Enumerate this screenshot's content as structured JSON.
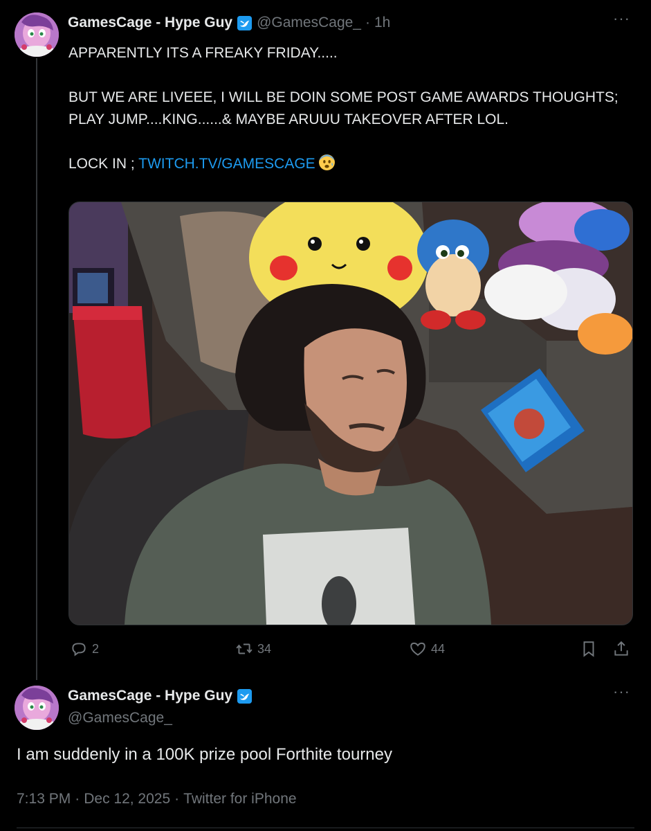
{
  "colors": {
    "background": "#000000",
    "text": "#e7e9ea",
    "muted": "#71767b",
    "link": "#1d9bf0",
    "verified": "#1d9bf0",
    "divider": "#2f3336"
  },
  "tweet1": {
    "display_name": "GamesCage - Hype Guy",
    "handle": "@GamesCage_",
    "separator": "·",
    "time": "1h",
    "more": "···",
    "verified_icon": "verified-badge-icon",
    "text": {
      "line1": "APPARENTLY ITS A FREAKY FRIDAY.....",
      "line2": "BUT WE ARE LIVEEE, I WILL BE DOIN SOME POST GAME AWARDS THOUGHTS; PLAY JUMP....KING......& MAYBE ARUUU TAKEOVER AFTER LOL.",
      "line3_prefix": "LOCK IN ; ",
      "link": "TWITCH.TV/GAMESCAGE",
      "emoji": "anxious-face-emoji"
    },
    "media_description_icon": "selfie-photo",
    "actions": {
      "reply_count": "2",
      "retweet_count": "34",
      "like_count": "44"
    }
  },
  "tweet2": {
    "display_name": "GamesCage - Hype Guy",
    "handle": "@GamesCage_",
    "more": "···",
    "text": "I am suddenly in a 100K prize pool Forthite tourney",
    "timestamp": "7:13 PM",
    "dot": "·",
    "date": "Dec 12, 2025",
    "source": "Twitter for iPhone"
  }
}
